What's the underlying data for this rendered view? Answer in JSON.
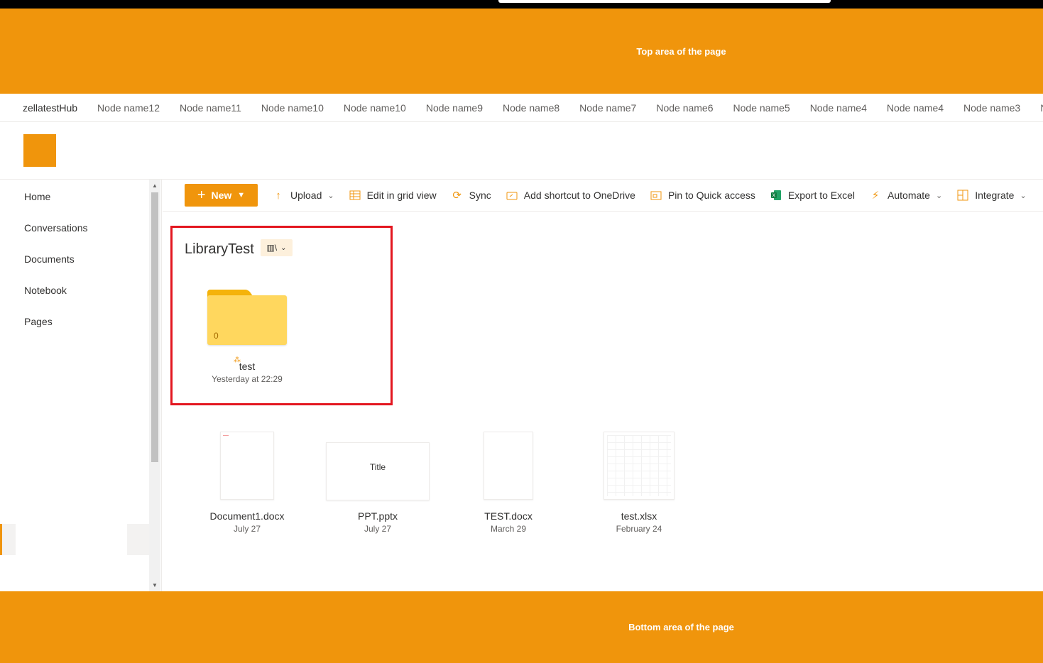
{
  "top_area": {
    "label": "Top area of the page"
  },
  "bottom_area": {
    "label": "Bottom area of the page"
  },
  "hub_nav": {
    "hub_name": "zellatestHub",
    "nodes": [
      "Node name12",
      "Node name11",
      "Node name10",
      "Node name10",
      "Node name9",
      "Node name8",
      "Node name7",
      "Node name6",
      "Node name5",
      "Node name4",
      "Node name4",
      "Node name3",
      "N"
    ]
  },
  "left_nav": {
    "items": [
      "Home",
      "Conversations",
      "Documents",
      "Notebook",
      "Pages"
    ]
  },
  "command_bar": {
    "new_label": "New",
    "upload_label": "Upload",
    "grid_label": "Edit in grid view",
    "sync_label": "Sync",
    "shortcut_label": "Add shortcut to OneDrive",
    "pin_label": "Pin to Quick access",
    "excel_label": "Export to Excel",
    "automate_label": "Automate",
    "integrate_label": "Integrate"
  },
  "library": {
    "title": "LibraryTest",
    "folder": {
      "name": "test",
      "count": "0",
      "date": "Yesterday at 22:29"
    }
  },
  "files": [
    {
      "name": "Document1.docx",
      "date": "July 27"
    },
    {
      "name": "PPT.pptx",
      "date": "July 27",
      "thumb_title": "Title"
    },
    {
      "name": "TEST.docx",
      "date": "March 29"
    },
    {
      "name": "test.xlsx",
      "date": "February 24"
    }
  ],
  "colors": {
    "accent": "#f0950c",
    "highlight_border": "#e3161f"
  }
}
